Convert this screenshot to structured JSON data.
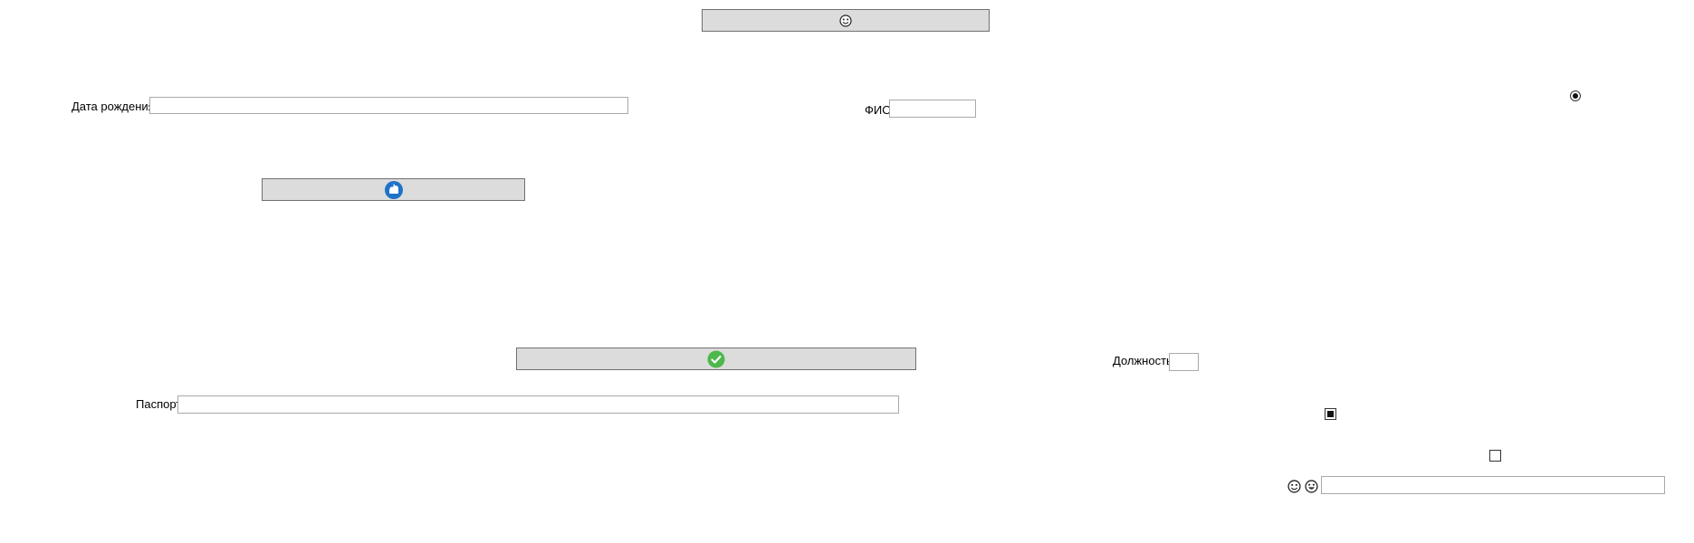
{
  "buttons": {
    "top": {
      "icon": "smiling-face-icon"
    },
    "middle": {
      "icon": "blue-cloud-badge-icon"
    },
    "confirm": {
      "icon": "green-check-icon"
    }
  },
  "fields": {
    "birth_date": {
      "label": "Дата рождения",
      "value": ""
    },
    "full_name": {
      "label": "ФИО",
      "value": ""
    },
    "position": {
      "label": "Должность",
      "value": ""
    },
    "passport": {
      "label": "Паспорт",
      "value": ""
    },
    "bottom_right": {
      "value": ""
    }
  },
  "radio": {
    "selected": true
  },
  "checkboxes": [
    {
      "state": "indeterminate"
    },
    {
      "state": "unchecked"
    }
  ],
  "emoji_icons": [
    "smiling-face-icon",
    "grinning-face-icon"
  ],
  "colors": {
    "button_bg": "#dcdcdc",
    "confirm_icon": "#4cb84c",
    "cloud_icon": "#1e73c8"
  }
}
